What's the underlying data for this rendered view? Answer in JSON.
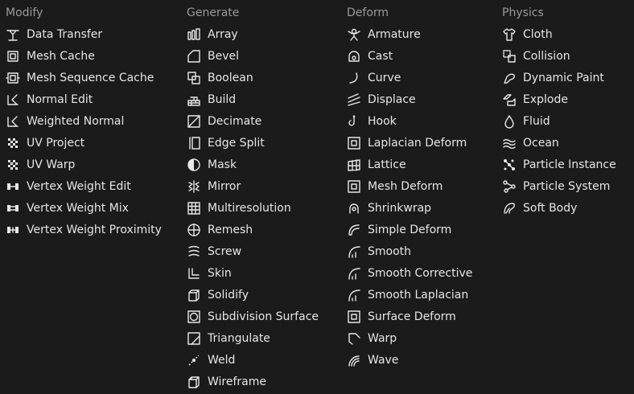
{
  "columns": [
    {
      "title": "Modify",
      "items": [
        {
          "label": "Data Transfer",
          "icon": "data-transfer-icon"
        },
        {
          "label": "Mesh Cache",
          "icon": "mesh-cache-icon"
        },
        {
          "label": "Mesh Sequence Cache",
          "icon": "mesh-sequence-cache-icon"
        },
        {
          "label": "Normal Edit",
          "icon": "normal-edit-icon"
        },
        {
          "label": "Weighted Normal",
          "icon": "weighted-normal-icon"
        },
        {
          "label": "UV Project",
          "icon": "uv-project-icon"
        },
        {
          "label": "UV Warp",
          "icon": "uv-warp-icon"
        },
        {
          "label": "Vertex Weight Edit",
          "icon": "vertex-weight-edit-icon"
        },
        {
          "label": "Vertex Weight Mix",
          "icon": "vertex-weight-mix-icon"
        },
        {
          "label": "Vertex Weight Proximity",
          "icon": "vertex-weight-proximity-icon"
        }
      ]
    },
    {
      "title": "Generate",
      "items": [
        {
          "label": "Array",
          "icon": "array-icon"
        },
        {
          "label": "Bevel",
          "icon": "bevel-icon"
        },
        {
          "label": "Boolean",
          "icon": "boolean-icon"
        },
        {
          "label": "Build",
          "icon": "build-icon"
        },
        {
          "label": "Decimate",
          "icon": "decimate-icon"
        },
        {
          "label": "Edge Split",
          "icon": "edge-split-icon"
        },
        {
          "label": "Mask",
          "icon": "mask-icon"
        },
        {
          "label": "Mirror",
          "icon": "mirror-icon"
        },
        {
          "label": "Multiresolution",
          "icon": "multiresolution-icon"
        },
        {
          "label": "Remesh",
          "icon": "remesh-icon"
        },
        {
          "label": "Screw",
          "icon": "screw-icon"
        },
        {
          "label": "Skin",
          "icon": "skin-icon"
        },
        {
          "label": "Solidify",
          "icon": "solidify-icon"
        },
        {
          "label": "Subdivision Surface",
          "icon": "subdivision-surface-icon"
        },
        {
          "label": "Triangulate",
          "icon": "triangulate-icon"
        },
        {
          "label": "Weld",
          "icon": "weld-icon"
        },
        {
          "label": "Wireframe",
          "icon": "wireframe-icon"
        }
      ]
    },
    {
      "title": "Deform",
      "items": [
        {
          "label": "Armature",
          "icon": "armature-icon"
        },
        {
          "label": "Cast",
          "icon": "cast-icon"
        },
        {
          "label": "Curve",
          "icon": "curve-icon"
        },
        {
          "label": "Displace",
          "icon": "displace-icon"
        },
        {
          "label": "Hook",
          "icon": "hook-icon"
        },
        {
          "label": "Laplacian Deform",
          "icon": "laplacian-deform-icon"
        },
        {
          "label": "Lattice",
          "icon": "lattice-icon"
        },
        {
          "label": "Mesh Deform",
          "icon": "mesh-deform-icon"
        },
        {
          "label": "Shrinkwrap",
          "icon": "shrinkwrap-icon"
        },
        {
          "label": "Simple Deform",
          "icon": "simple-deform-icon"
        },
        {
          "label": "Smooth",
          "icon": "smooth-icon"
        },
        {
          "label": "Smooth Corrective",
          "icon": "smooth-corrective-icon"
        },
        {
          "label": "Smooth Laplacian",
          "icon": "smooth-laplacian-icon"
        },
        {
          "label": "Surface Deform",
          "icon": "surface-deform-icon"
        },
        {
          "label": "Warp",
          "icon": "warp-icon"
        },
        {
          "label": "Wave",
          "icon": "wave-icon"
        }
      ]
    },
    {
      "title": "Physics",
      "items": [
        {
          "label": "Cloth",
          "icon": "cloth-icon"
        },
        {
          "label": "Collision",
          "icon": "collision-icon"
        },
        {
          "label": "Dynamic Paint",
          "icon": "dynamic-paint-icon"
        },
        {
          "label": "Explode",
          "icon": "explode-icon"
        },
        {
          "label": "Fluid",
          "icon": "fluid-icon"
        },
        {
          "label": "Ocean",
          "icon": "ocean-icon"
        },
        {
          "label": "Particle Instance",
          "icon": "particle-instance-icon"
        },
        {
          "label": "Particle System",
          "icon": "particle-system-icon"
        },
        {
          "label": "Soft Body",
          "icon": "soft-body-icon"
        }
      ]
    }
  ]
}
